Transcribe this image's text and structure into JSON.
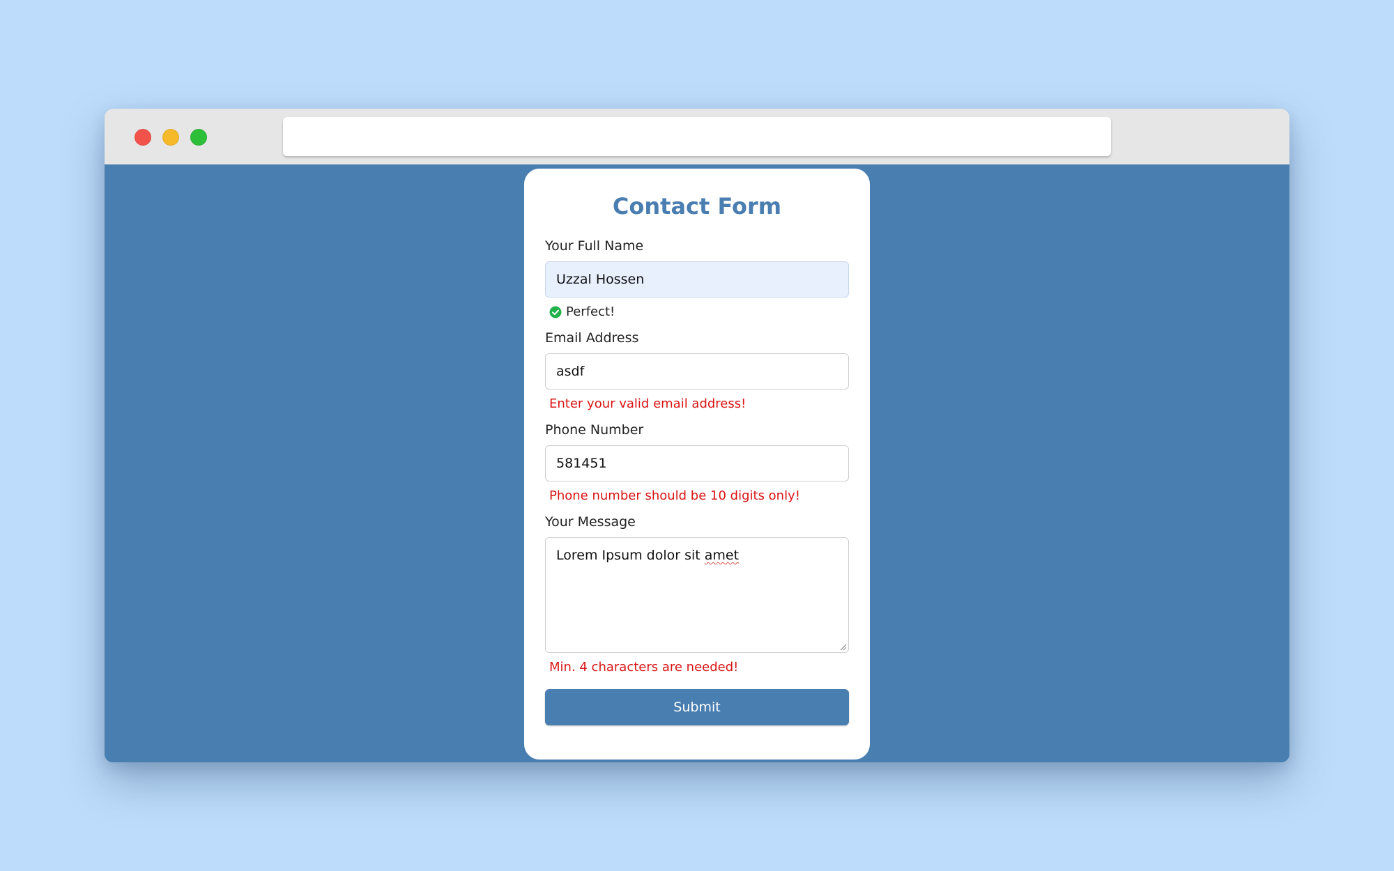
{
  "browser": {
    "url": ""
  },
  "form": {
    "title": "Contact Form",
    "fields": {
      "name": {
        "label": "Your Full Name",
        "value": "Uzzal Hossen",
        "message": "Perfect!"
      },
      "email": {
        "label": "Email Address",
        "value": "asdf",
        "message": "Enter your valid email address!"
      },
      "phone": {
        "label": "Phone Number",
        "value": "581451",
        "message": "Phone number should be 10 digits only!"
      },
      "message": {
        "label": "Your Message",
        "value_prefix": "Lorem Ipsum dolor sit ",
        "value_misspelled": "amet",
        "message": "Min. 4 characters are needed!"
      }
    },
    "submit_label": "Submit"
  },
  "colors": {
    "page_background": "#bddcfb",
    "content_background": "#497eb0",
    "accent": "#4a7eb1",
    "error": "#d91414",
    "success": "#22b24c"
  },
  "icons": {
    "success": "check-circle-icon",
    "window_close": "close-dot",
    "window_minimize": "minimize-dot",
    "window_zoom": "zoom-dot"
  }
}
